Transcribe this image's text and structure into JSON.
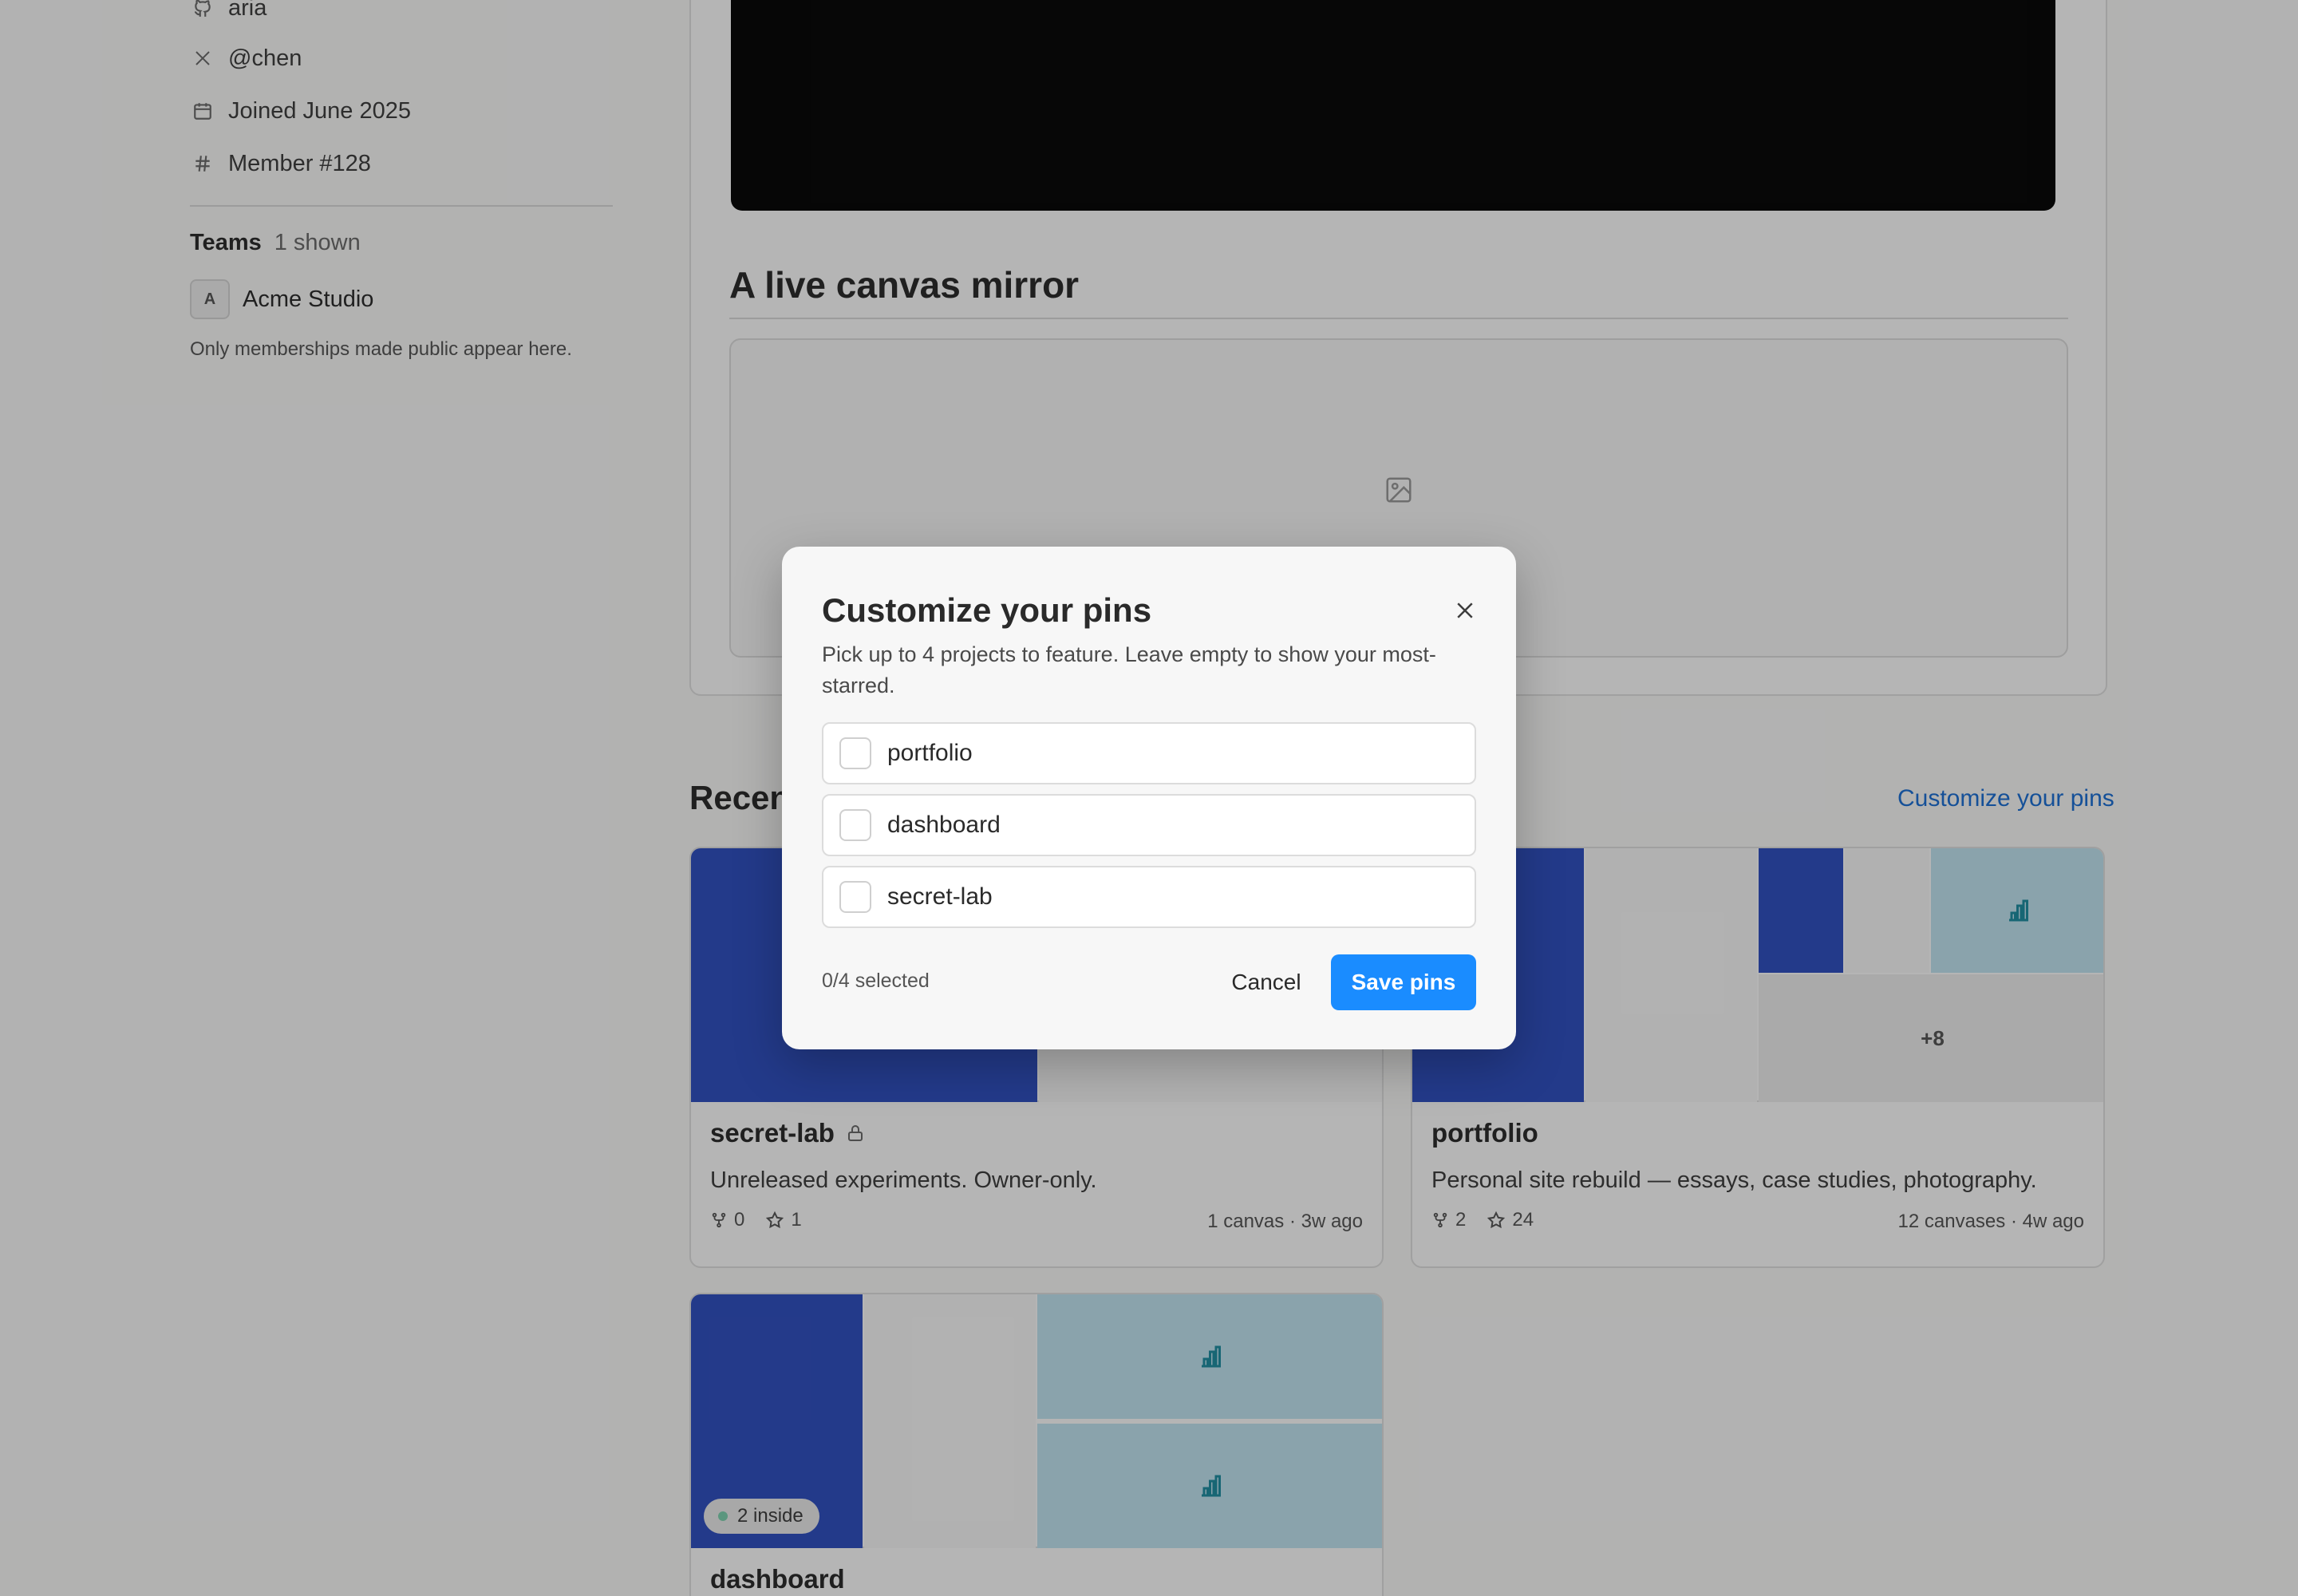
{
  "profile": {
    "handle_github": "aria",
    "handle_x": "@chen",
    "joined": "Joined June 2025",
    "member": "Member #128",
    "teams_label": "Teams",
    "teams_count": "1 shown",
    "team_avatar": "A",
    "team_name": "Acme Studio",
    "teams_note": "Only memberships made public appear here."
  },
  "main": {
    "mirror_title": "A live canvas mirror",
    "recent_title": "Recen",
    "customize_link": "Customize your pins"
  },
  "projects": [
    {
      "name": "secret-lab",
      "description": "Unreleased experiments. Owner-only.",
      "forks": "0",
      "stars": "1",
      "meta": "1 canvas · 3w ago",
      "private": true
    },
    {
      "name": "portfolio",
      "description": "Personal site rebuild — essays, case studies, photography.",
      "forks": "2",
      "stars": "24",
      "meta": "12 canvases · 4w ago",
      "more_count": "+8"
    },
    {
      "name": "dashboard",
      "inside_badge": "2 inside"
    }
  ],
  "modal": {
    "title": "Customize your pins",
    "description": "Pick up to 4 projects to feature. Leave empty to show your most-starred.",
    "options": [
      {
        "label": "portfolio",
        "checked": false
      },
      {
        "label": "dashboard",
        "checked": false
      },
      {
        "label": "secret-lab",
        "checked": false
      }
    ],
    "selected_count": "0/4 selected",
    "cancel_label": "Cancel",
    "save_label": "Save pins"
  },
  "colors": {
    "accent": "#1a8cff",
    "link": "#1a6fd6",
    "tile_navy": "#2f4fc2",
    "tile_teal": "#c2e6f2"
  }
}
